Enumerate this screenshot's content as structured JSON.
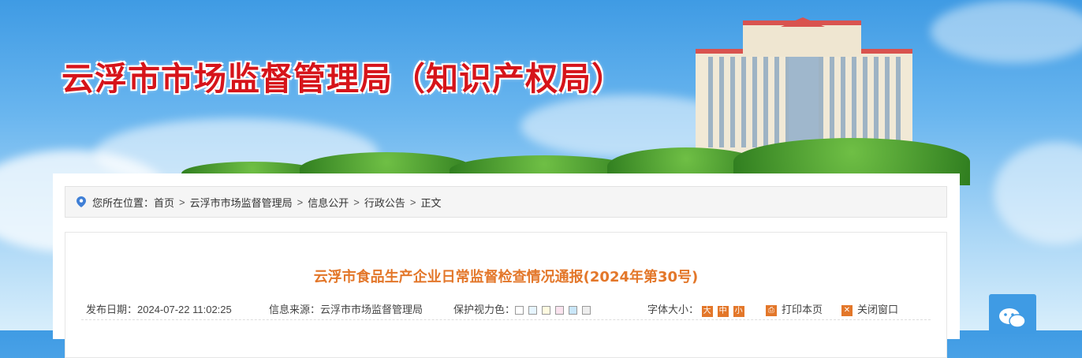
{
  "header": {
    "site_title": "云浮市市场监督管理局（知识产权局）"
  },
  "breadcrumb": {
    "prefix": "您所在位置：",
    "items": [
      "首页",
      "云浮市市场监督管理局",
      "信息公开",
      "行政公告",
      "正文"
    ],
    "separator": ">"
  },
  "article": {
    "title": "云浮市食品生产企业日常监督检查情况通报(2024年第30号)",
    "publish_date": "发布日期：2024-07-22 11:02:25",
    "source": "信息来源：云浮市市场监督管理局",
    "eye_care_label": "保护视力色：",
    "eye_care_colors": [
      "#ffffff",
      "#e6f5ff",
      "#fffbe0",
      "#fbe3ef",
      "#c9e6f9",
      "#eeeeee"
    ],
    "font_size_label": "字体大小：",
    "font_sizes": [
      "大",
      "中",
      "小"
    ],
    "print_label": "打印本页",
    "close_label": "关闭窗口"
  },
  "colors": {
    "title_red": "#d6141a",
    "accent_orange": "#e3772a",
    "sky_blue": "#3f9be4"
  },
  "icons": {
    "location": "map-pin-icon",
    "print": "print-icon",
    "close": "close-icon",
    "wechat": "wechat-icon"
  }
}
